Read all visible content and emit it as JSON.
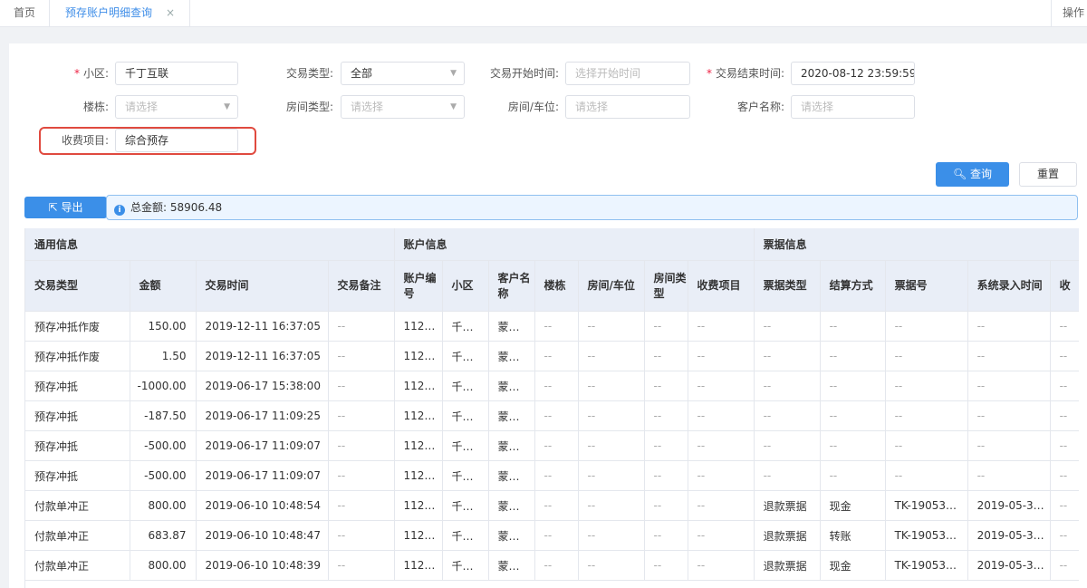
{
  "tabs": {
    "home": "首页",
    "active": "预存账户明细查询",
    "close": "×",
    "ops": "操作"
  },
  "form": {
    "community_label": "小区:",
    "community_value": "千丁互联",
    "txn_type_label": "交易类型:",
    "txn_type_value": "全部",
    "start_time_label": "交易开始时间:",
    "start_time_placeholder": "选择开始时间",
    "end_time_label": "交易结束时间:",
    "end_time_value": "2020-08-12 23:59:59",
    "building_label": "楼栋:",
    "building_placeholder": "请选择",
    "room_type_label": "房间类型:",
    "room_type_placeholder": "请选择",
    "room_label": "房间/车位:",
    "room_placeholder": "请选择",
    "customer_label": "客户名称:",
    "customer_placeholder": "请选择",
    "fee_item_label": "收费项目:",
    "fee_item_value": "综合预存",
    "required_mark": "*"
  },
  "buttons": {
    "query": "查询",
    "reset": "重置",
    "export": "导出"
  },
  "total": {
    "label": "总金额:",
    "value": "58906.48"
  },
  "table": {
    "groups": [
      "通用信息",
      "账户信息",
      "票据信息"
    ],
    "columns": [
      "交易类型",
      "金额",
      "交易时间",
      "交易备注",
      "账户编号",
      "小区",
      "客户名称",
      "楼栋",
      "房间/车位",
      "房间类型",
      "收费项目",
      "票据类型",
      "结算方式",
      "票据号",
      "系统录入时间",
      "收"
    ],
    "rows": [
      [
        "预存冲抵作废",
        "150.00",
        "2019-12-11 16:37:05",
        "--",
        "112…",
        "千…",
        "蒙…",
        "--",
        "--",
        "--",
        "--",
        "--",
        "--",
        "--",
        "--",
        "--"
      ],
      [
        "预存冲抵作废",
        "1.50",
        "2019-12-11 16:37:05",
        "--",
        "112…",
        "千…",
        "蒙…",
        "--",
        "--",
        "--",
        "--",
        "--",
        "--",
        "--",
        "--",
        "--"
      ],
      [
        "预存冲抵",
        "-1000.00",
        "2019-06-17 15:38:00",
        "--",
        "112…",
        "千…",
        "蒙…",
        "--",
        "--",
        "--",
        "--",
        "--",
        "--",
        "--",
        "--",
        "--"
      ],
      [
        "预存冲抵",
        "-187.50",
        "2019-06-17 11:09:25",
        "--",
        "112…",
        "千…",
        "蒙…",
        "--",
        "--",
        "--",
        "--",
        "--",
        "--",
        "--",
        "--",
        "--"
      ],
      [
        "预存冲抵",
        "-500.00",
        "2019-06-17 11:09:07",
        "--",
        "112…",
        "千…",
        "蒙…",
        "--",
        "--",
        "--",
        "--",
        "--",
        "--",
        "--",
        "--",
        "--"
      ],
      [
        "预存冲抵",
        "-500.00",
        "2019-06-17 11:09:07",
        "--",
        "112…",
        "千…",
        "蒙…",
        "--",
        "--",
        "--",
        "--",
        "--",
        "--",
        "--",
        "--",
        "--"
      ],
      [
        "付款单冲正",
        "800.00",
        "2019-06-10 10:48:54",
        "--",
        "112…",
        "千…",
        "蒙…",
        "--",
        "--",
        "--",
        "--",
        "退款票据",
        "现金",
        "TK-19053…",
        "2019-05-3…",
        "--"
      ],
      [
        "付款单冲正",
        "683.87",
        "2019-06-10 10:48:47",
        "--",
        "112…",
        "千…",
        "蒙…",
        "--",
        "--",
        "--",
        "--",
        "退款票据",
        "转账",
        "TK-19053…",
        "2019-05-3…",
        "--"
      ],
      [
        "付款单冲正",
        "800.00",
        "2019-06-10 10:48:39",
        "--",
        "112…",
        "千…",
        "蒙…",
        "--",
        "--",
        "--",
        "--",
        "退款票据",
        "现金",
        "TK-19053…",
        "2019-05-3…",
        "--"
      ]
    ]
  },
  "colors": {
    "accent": "#3b8fe8",
    "highlight": "#e04a3f"
  }
}
